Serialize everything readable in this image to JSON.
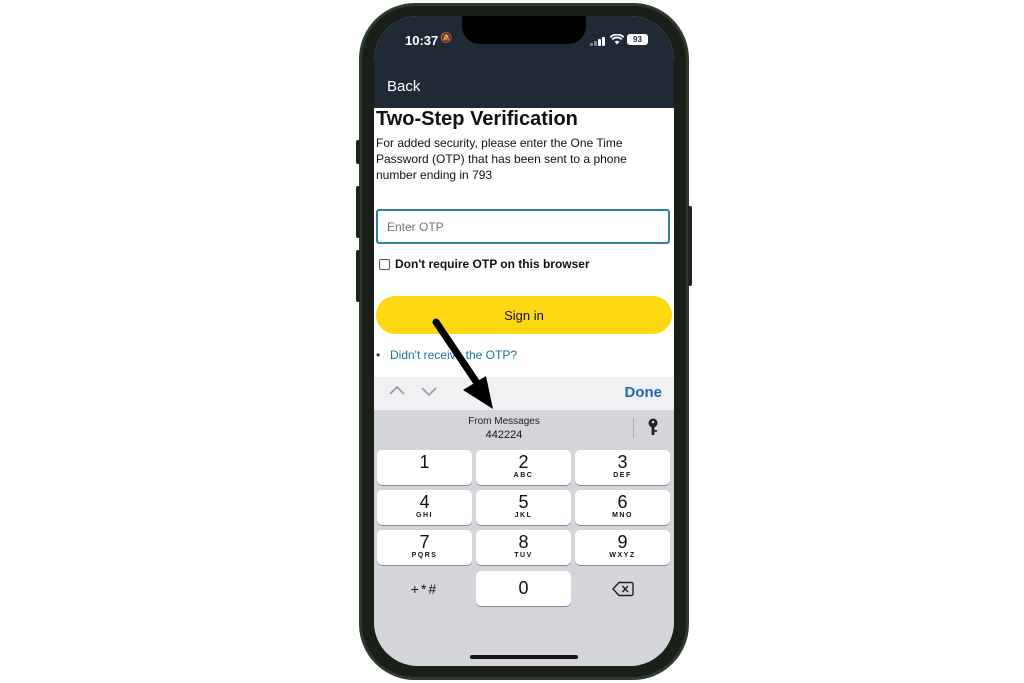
{
  "status": {
    "time": "10:37",
    "battery": "93"
  },
  "nav": {
    "back_label": "Back"
  },
  "page": {
    "title": "Two-Step Verification",
    "description": "For added security, please enter the One Time Password (OTP) that has been sent to a phone number ending in 793",
    "otp_placeholder": "Enter OTP",
    "checkbox_label": "Don't require OTP on this browser",
    "checkbox_checked": false,
    "signin_label": "Sign in",
    "resend_link": "Didn't receive the OTP?"
  },
  "keyboard_toolbar": {
    "done_label": "Done"
  },
  "suggestion": {
    "from": "From Messages",
    "code": "442224"
  },
  "keypad": {
    "keys": [
      {
        "num": "1",
        "letters": ""
      },
      {
        "num": "2",
        "letters": "ABC"
      },
      {
        "num": "3",
        "letters": "DEF"
      },
      {
        "num": "4",
        "letters": "GHI"
      },
      {
        "num": "5",
        "letters": "JKL"
      },
      {
        "num": "6",
        "letters": "MNO"
      },
      {
        "num": "7",
        "letters": "PQRS"
      },
      {
        "num": "8",
        "letters": "TUV"
      },
      {
        "num": "9",
        "letters": "WXYZ"
      },
      {
        "num": "+*#",
        "letters": ""
      },
      {
        "num": "0",
        "letters": ""
      }
    ]
  },
  "colors": {
    "header_bg": "#202a36",
    "signin_yellow": "#ffd814",
    "link_blue": "#1e6f99",
    "done_blue": "#1e66b8",
    "input_border": "#2f7fa4",
    "keypad_bg": "#d3d5db"
  }
}
